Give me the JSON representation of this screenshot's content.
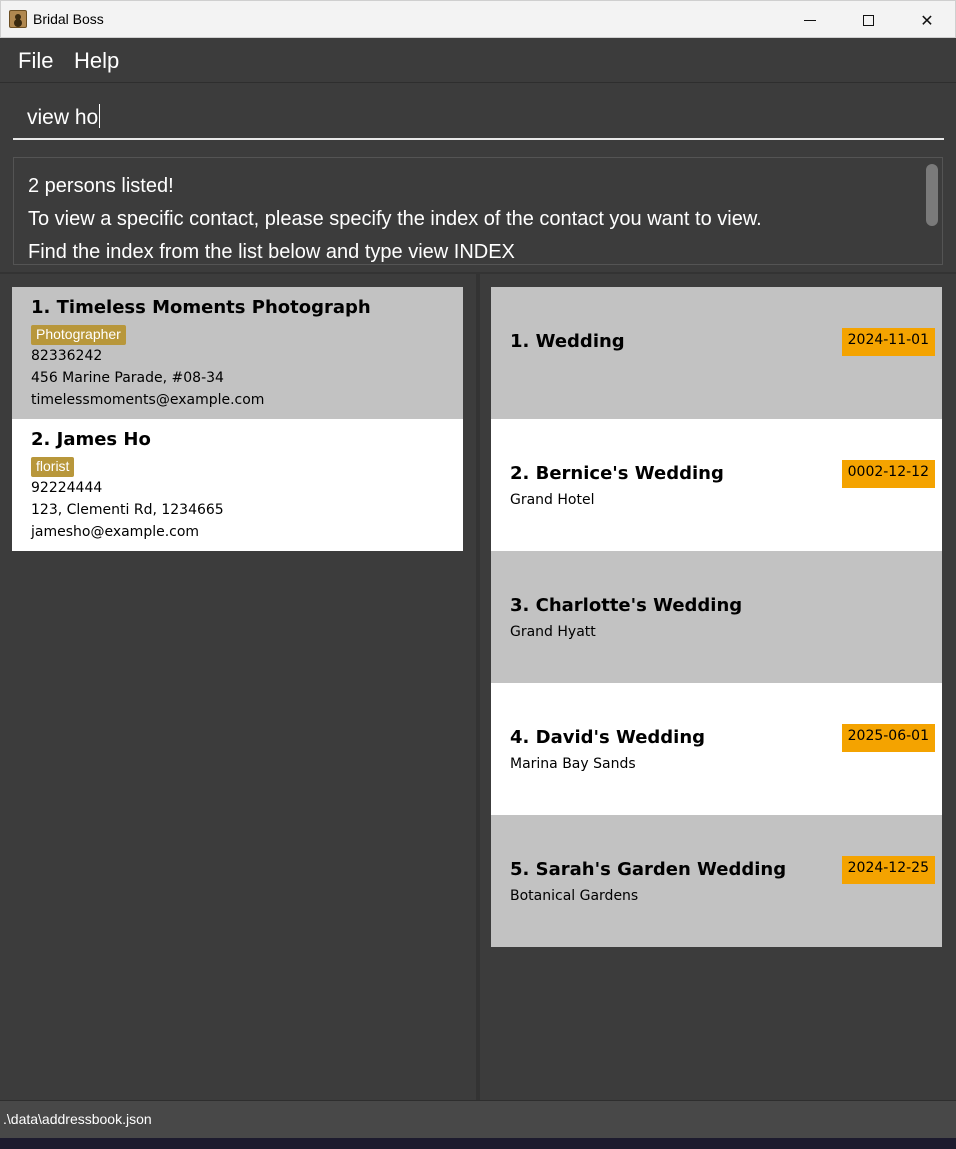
{
  "window": {
    "title": "Bridal Boss",
    "minimize_label": "",
    "close_glyph": "✕"
  },
  "menu": {
    "file": "File",
    "help": "Help"
  },
  "command": {
    "value": "view ho"
  },
  "result": {
    "lines": [
      "2 persons listed!",
      "To view a specific contact, please specify the index of the contact you want to view.",
      "Find the index from the list below and type view INDEX"
    ]
  },
  "persons": [
    {
      "name": "1. Timeless Moments Photograph",
      "tag": "Photographer",
      "phone": "82336242",
      "address": "456 Marine Parade, #08-34",
      "email": "timelessmoments@example.com"
    },
    {
      "name": "2. James Ho",
      "tag": "florist",
      "phone": "92224444",
      "address": "123, Clementi Rd, 1234665",
      "email": "jamesho@example.com"
    }
  ],
  "weddings": [
    {
      "title": "1. Wedding",
      "venue": "",
      "date": "2024-11-01"
    },
    {
      "title": "2. Bernice's Wedding",
      "venue": "Grand Hotel",
      "date": "0002-12-12"
    },
    {
      "title": "3. Charlotte's Wedding",
      "venue": "Grand Hyatt",
      "date": ""
    },
    {
      "title": "4. David's Wedding",
      "venue": "Marina Bay Sands",
      "date": "2025-06-01"
    },
    {
      "title": "5. Sarah's Garden Wedding",
      "venue": "Botanical Gardens",
      "date": "2024-12-25"
    }
  ],
  "status": {
    "path": ".\\data\\addressbook.json"
  },
  "colors": {
    "background": "#3c3c3c",
    "card_grey": "#c2c2c2",
    "card_white": "#ffffff",
    "tag": "#b8973b",
    "date_badge": "#f4a300"
  }
}
